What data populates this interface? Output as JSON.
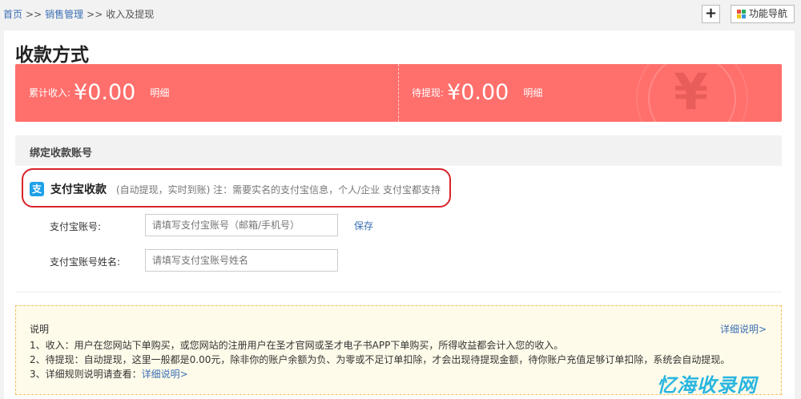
{
  "breadcrumb": {
    "home": "首页",
    "sep1": ">>",
    "sales": "销售管理",
    "sep2": ">>",
    "current": "收入及提现"
  },
  "toolbar": {
    "add_label": "+",
    "nav_label": "功能导航"
  },
  "page_title": "收款方式",
  "banner": {
    "total_label": "累计收入:",
    "total_value": "¥0.00",
    "total_detail": "明细",
    "pending_label": "待提现:",
    "pending_value": "¥0.00",
    "pending_detail": "明细",
    "bg_glyph": "¥",
    "color": "#ff6f6c"
  },
  "section": {
    "title": "绑定收款账号"
  },
  "alipay": {
    "icon_char": "支",
    "name": "支付宝收款",
    "note": "(自动提现，实时到账) 注：需要实名的支付宝信息，个人/企业 支付宝都支持",
    "icon_color": "#1da1e8"
  },
  "form": {
    "account_label": "支付宝账号:",
    "account_placeholder": "请填写支付宝账号（邮箱/手机号）",
    "name_label": "支付宝账号姓名:",
    "name_placeholder": "请填写支付宝账号姓名",
    "save_label": "保存"
  },
  "notes": {
    "title": "说明",
    "more": "详细说明>",
    "line1": "1、收入：用户在您网站下单购买，或您网站的注册用户在圣才官网或圣才电子书APP下单购买，所得收益都会计入您的收入。",
    "line2": "2、待提现：自动提现，这里一般都是0.00元，除非你的账户余额为负、为零或不足订单扣除，才会出现待提现金额，待你账户充值足够订单扣除，系统会自动提现。",
    "line3_prefix": "3、详细规则说明请查看：",
    "line3_link": "详细说明>"
  },
  "watermark": "忆海收录网"
}
